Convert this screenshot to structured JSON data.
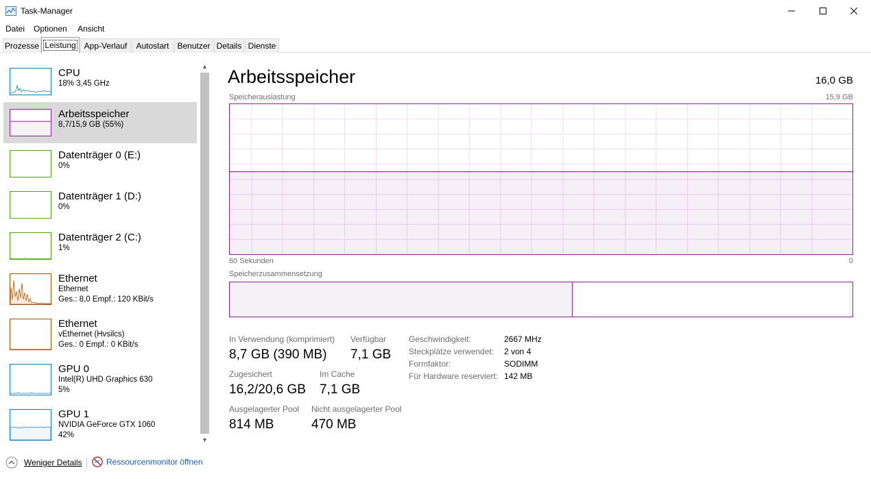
{
  "window": {
    "title": "Task-Manager"
  },
  "menu": [
    "Datei",
    "Optionen",
    "Ansicht"
  ],
  "tabs": [
    "Prozesse",
    "Leistung",
    "App-Verlauf",
    "Autostart",
    "Benutzer",
    "Details",
    "Dienste"
  ],
  "active_tab": "Leistung",
  "sidebar": [
    {
      "name": "CPU",
      "line1": "18% 3,45 GHz",
      "color": "#117dbb"
    },
    {
      "name": "Arbeitsspeicher",
      "line1": "8,7/15,9 GB (55%)",
      "color": "#8b1f96",
      "selected": true,
      "fill": 0.55
    },
    {
      "name": "Datenträger 0 (E:)",
      "line1": "0%",
      "color": "#4da60c"
    },
    {
      "name": "Datenträger 1 (D:)",
      "line1": "0%",
      "color": "#4da60c"
    },
    {
      "name": "Datenträger 2 (C:)",
      "line1": "1%",
      "color": "#4da60c"
    },
    {
      "name": "Ethernet",
      "line1": "Ethernet",
      "line2": "Ges.: 8,0 Empf.: 120 KBit/s",
      "color": "#a74f01"
    },
    {
      "name": "Ethernet",
      "line1": "vEthernet (Hvsilcs)",
      "line2": "Ges.: 0 Empf.: 0 KBit/s",
      "color": "#a74f01"
    },
    {
      "name": "GPU 0",
      "line1": "Intel(R) UHD Graphics 630",
      "line2": "5%",
      "color": "#117dbb"
    },
    {
      "name": "GPU 1",
      "line1": "NVIDIA GeForce GTX 1060",
      "line2": "42%",
      "color": "#117dbb"
    }
  ],
  "main": {
    "title": "Arbeitsspeicher",
    "total": "16,0 GB",
    "usage_label": "Speicherauslastung",
    "usage_max": "15,9 GB",
    "time_left": "60 Sekunden",
    "time_right": "0",
    "usage_level": 0.55,
    "composition_label": "Speicherzusammensetzung",
    "composition_in_use": 0.55,
    "stats": {
      "in_use_label": "In Verwendung (komprimiert)",
      "in_use_value": "8,7 GB (390 MB)",
      "available_label": "Verfügbar",
      "available_value": "7,1 GB",
      "committed_label": "Zugesichert",
      "committed_value": "16,2/20,6 GB",
      "cached_label": "Im Cache",
      "cached_value": "7,1 GB",
      "paged_label": "Ausgelagerter Pool",
      "paged_value": "814 MB",
      "nonpaged_label": "Nicht ausgelagerter Pool",
      "nonpaged_value": "470 MB"
    },
    "details": [
      {
        "key": "Geschwindigkeit:",
        "value": "2667 MHz"
      },
      {
        "key": "Steckplätze verwendet:",
        "value": "2 von 4"
      },
      {
        "key": "Formfaktor:",
        "value": "SODIMM"
      },
      {
        "key": "Für Hardware reserviert:",
        "value": "142 MB"
      }
    ]
  },
  "footer": {
    "fewer_details": "Weniger Details",
    "resource_monitor": "Ressourcenmonitor öffnen"
  }
}
